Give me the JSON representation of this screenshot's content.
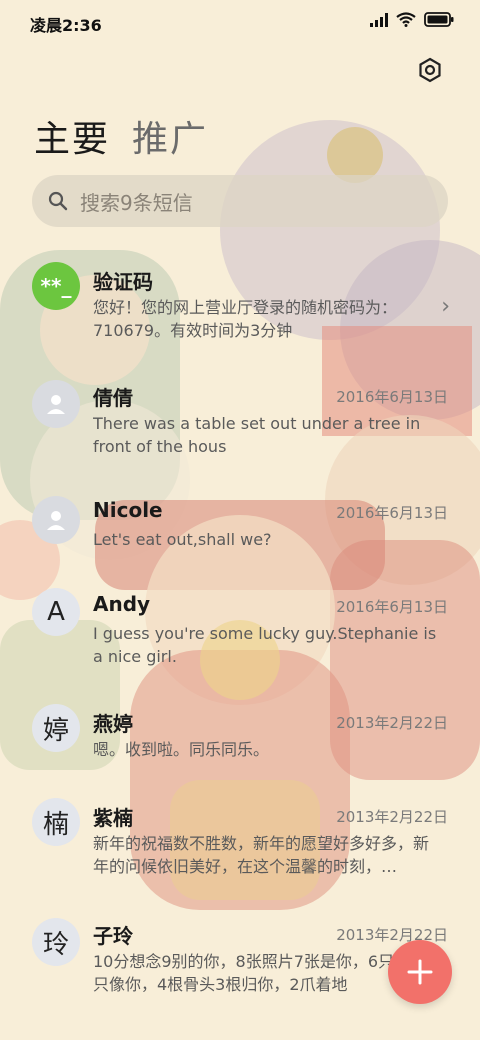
{
  "status_bar": {
    "time": "凌晨2:36",
    "signal_icon": "signal-icon",
    "wifi_icon": "wifi-icon",
    "battery_icon": "battery-icon"
  },
  "header": {
    "settings_icon": "settings-icon",
    "tabs": [
      {
        "label": "主要",
        "active": true
      },
      {
        "label": "推广",
        "active": false
      }
    ]
  },
  "search": {
    "icon": "search-icon",
    "placeholder": "搜索9条短信"
  },
  "conversations": [
    {
      "avatar_text": "**_",
      "avatar_type": "verification",
      "name": "验证码",
      "date": "",
      "preview": "您好！您的网上营业厅登录的随机密码为：710679。有效时间为3分钟",
      "chevron": "›"
    },
    {
      "avatar_text": "",
      "avatar_type": "person",
      "name": "倩倩",
      "date": "2016年6月13日",
      "preview": "There was a table set out under a tree in front of the hous"
    },
    {
      "avatar_text": "",
      "avatar_type": "person",
      "name": "Nicole",
      "date": "2016年6月13日",
      "preview": "Let's eat out,shall we?"
    },
    {
      "avatar_text": "A",
      "avatar_type": "letter",
      "name": "Andy",
      "date": "2016年6月13日",
      "preview": "I guess you're some lucky guy.Stephanie is a nice girl."
    },
    {
      "avatar_text": "婷",
      "avatar_type": "letter",
      "name": "燕婷",
      "date": "2013年2月22日",
      "preview": "嗯。收到啦。同乐同乐。"
    },
    {
      "avatar_text": "楠",
      "avatar_type": "letter",
      "name": "紫楠",
      "date": "2013年2月22日",
      "preview": "新年的祝福数不胜数，新年的愿望好多好多，新年的问候依旧美好，在这个温馨的时刻，…"
    },
    {
      "avatar_text": "玲",
      "avatar_type": "letter",
      "name": "子玲",
      "date": "2013年2月22日",
      "preview": "10分想念9别的你，8张照片7张是你，6只小狗5只像你，4根骨头3根归你，2爪着地"
    }
  ],
  "fab": {
    "icon": "plus-icon",
    "label": "+"
  },
  "colors": {
    "accent": "#f2716a",
    "verify_avatar": "#6cc63f",
    "background": "#f7ecd3"
  }
}
